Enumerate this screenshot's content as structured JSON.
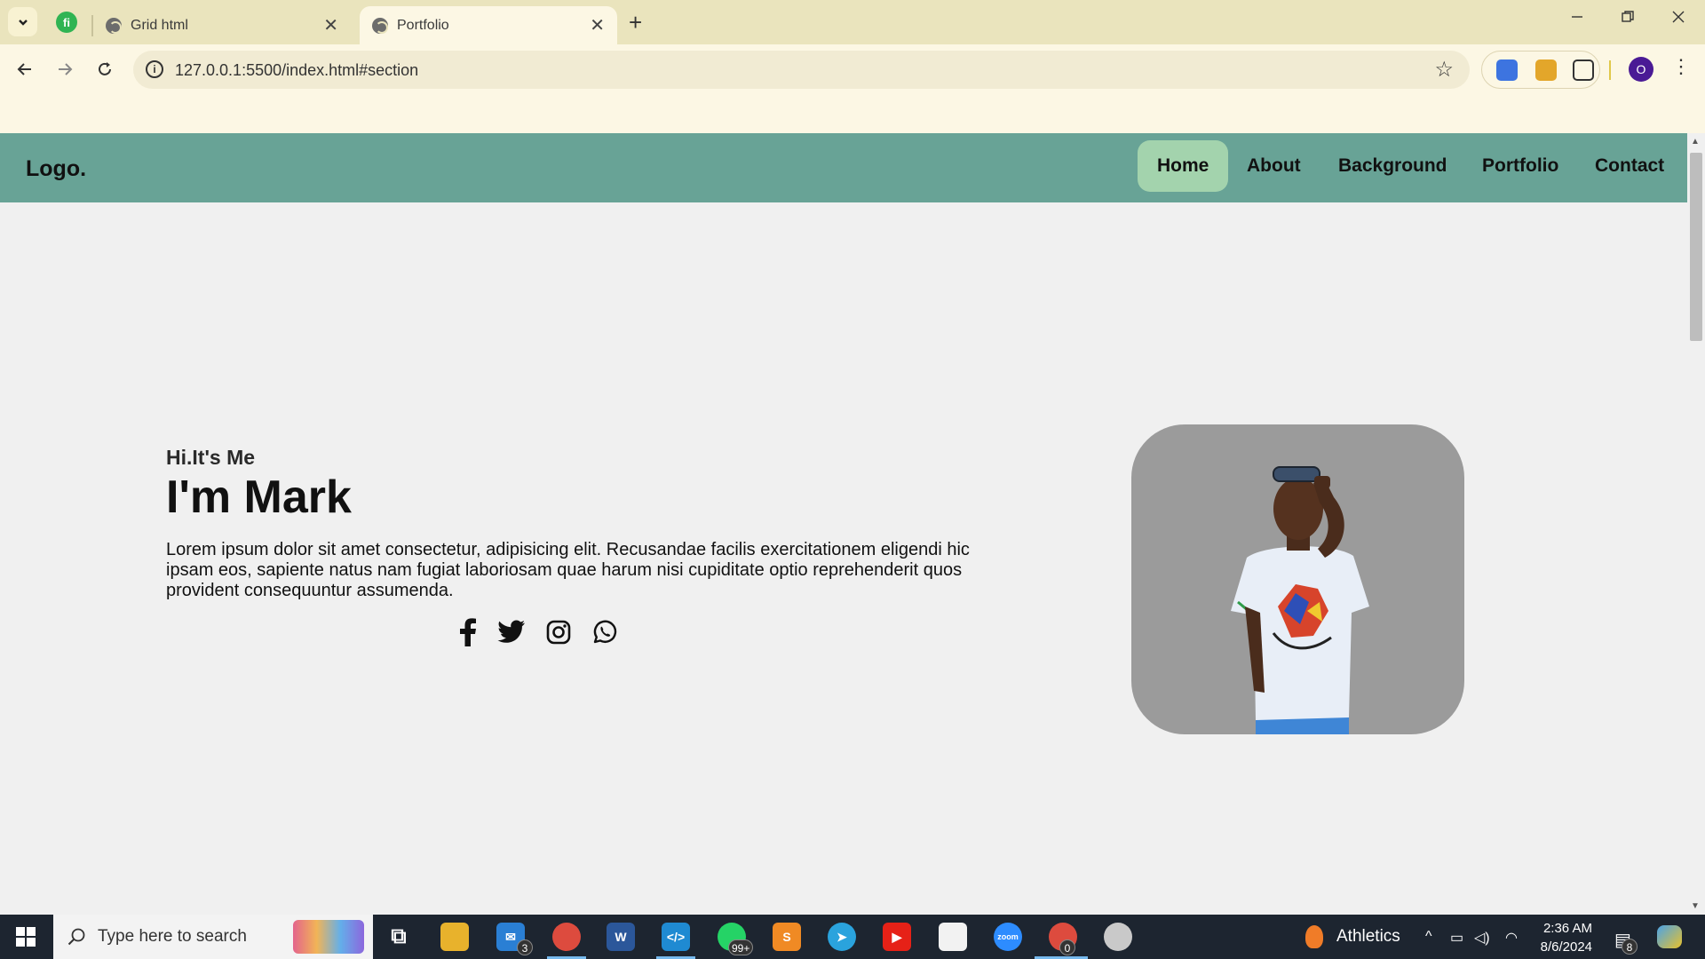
{
  "browser": {
    "tabs": [
      {
        "title": "Grid html"
      },
      {
        "title": "Portfolio"
      }
    ],
    "url": "127.0.0.1:5500/index.html#section",
    "profile_initial": "O"
  },
  "site": {
    "logo": "Logo.",
    "nav": [
      {
        "label": "Home",
        "active": true
      },
      {
        "label": "About"
      },
      {
        "label": "Background"
      },
      {
        "label": "Portfolio"
      },
      {
        "label": "Contact"
      }
    ],
    "hero": {
      "greeting": "Hi.It's Me",
      "headline": "I'm Mark",
      "bio": "Lorem ipsum dolor sit amet consectetur, adipisicing elit. Recusandae facilis exercitationem eligendi hic ipsam eos, sapiente natus nam fugiat laboriosam quae harum nisi cupiditate optio reprehenderit quos provident consequuntur assumenda.",
      "social_icons": [
        "facebook-icon",
        "twitter-icon",
        "instagram-icon",
        "whatsapp-icon"
      ]
    },
    "colors": {
      "nav_bg": "#68a396",
      "nav_active": "#a3d3ad",
      "page_bg": "#f0f0f0",
      "photo_bg": "#9b9b9b"
    }
  },
  "taskbar": {
    "search_placeholder": "Type here to search",
    "mail_badge": "3",
    "whatsapp_badge": "99+",
    "chrome_badge": "0",
    "weather": "Athletics",
    "time": "2:36 AM",
    "date": "8/6/2024",
    "notifications": "8"
  }
}
